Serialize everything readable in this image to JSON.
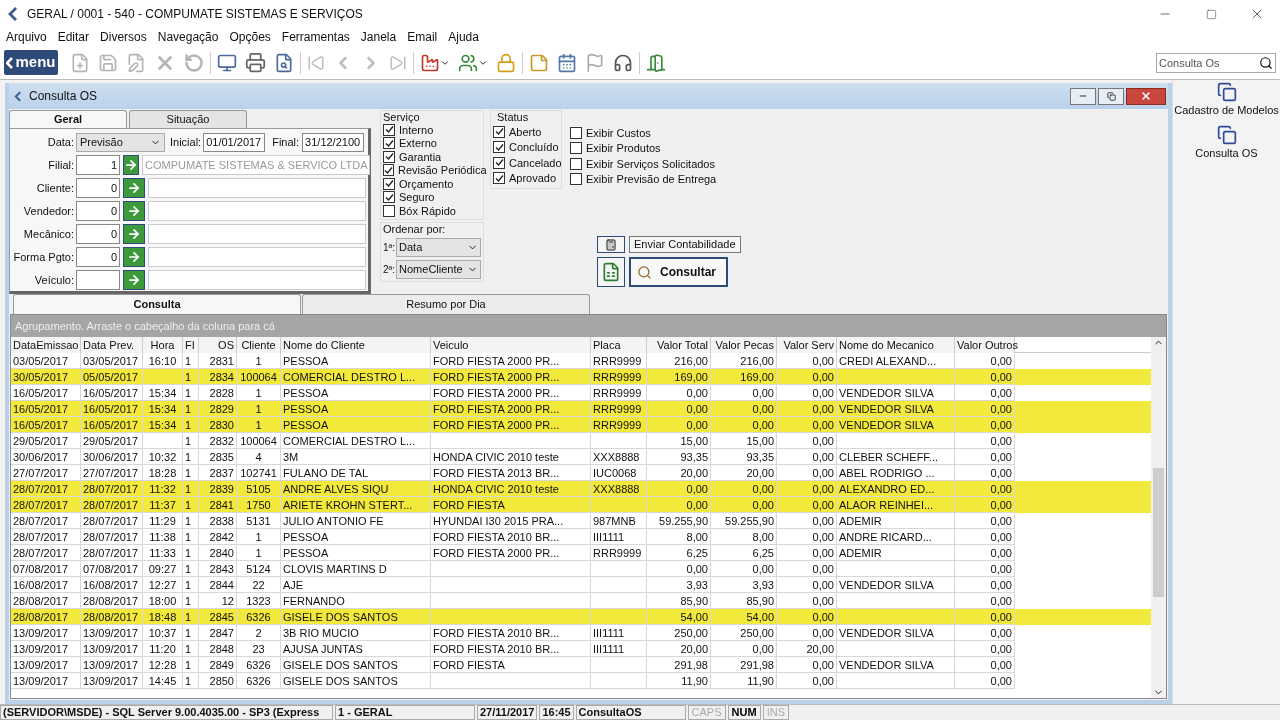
{
  "window": {
    "title": "GERAL / 0001 - 540 - COMPUMATE SISTEMAS E SERVIÇOS"
  },
  "menu": [
    "Arquivo",
    "Editar",
    "Diversos",
    "Navegação",
    "Opções",
    "Ferramentas",
    "Janela",
    "Email",
    "Ajuda"
  ],
  "toolbar": {
    "menu_button": "menu",
    "search": {
      "placeholder": "Consulta Os"
    }
  },
  "side_panel": [
    "Cadastro de Modelos",
    "Consulta OS"
  ],
  "child_window": {
    "title": "Consulta OS"
  },
  "top_tabs": [
    {
      "label": "Geral",
      "selected": true
    },
    {
      "label": "Situação",
      "selected": false
    }
  ],
  "date_row": {
    "label": "Data:",
    "value": "Previsão",
    "start_label": "Inicial:",
    "start": "01/01/2017",
    "end_label": "Final:",
    "end": "31/12/2100"
  },
  "filters": [
    {
      "label": "Filial:",
      "code": "1",
      "description": "COMPUMATE SISTEMAS & SERVICO LTDA"
    },
    {
      "label": "Cliente:",
      "code": "0"
    },
    {
      "label": "Vendedor:",
      "code": "0"
    },
    {
      "label": "Mecânico:",
      "code": "0"
    },
    {
      "label": "Forma Pgto:",
      "code": "0"
    },
    {
      "label": "Veículo:"
    }
  ],
  "servico": {
    "title": "Serviço",
    "items": [
      {
        "label": "Interno",
        "checked": true
      },
      {
        "label": "Externo",
        "checked": true
      },
      {
        "label": "Garantia",
        "checked": true
      },
      {
        "label": "Revisão Periódica",
        "checked": true
      },
      {
        "label": "Orçamento",
        "checked": true
      },
      {
        "label": "Seguro",
        "checked": true
      },
      {
        "label": "Bóx Rápido",
        "checked": false
      }
    ]
  },
  "status": {
    "title": "Status",
    "items": [
      {
        "label": "Aberto",
        "checked": true
      },
      {
        "label": "Concluído",
        "checked": true
      },
      {
        "label": "Cancelado",
        "checked": true
      },
      {
        "label": "Aprovado",
        "checked": true
      }
    ]
  },
  "options": [
    {
      "label": "Exibir Custos",
      "checked": false
    },
    {
      "label": "Exibir Produtos",
      "checked": false
    },
    {
      "label": "Exibir Serviços Solicitados",
      "checked": false
    },
    {
      "label": "Exibir Previsão de Entrega",
      "checked": false
    }
  ],
  "ordenar": {
    "title": "Ordenar por:",
    "items": [
      {
        "label": "1ª:",
        "value": "Data"
      },
      {
        "label": "2ª:",
        "value": "NomeCliente"
      }
    ]
  },
  "buttons": {
    "send": "Enviar Contabilidade",
    "search": "Consultar"
  },
  "bottom_tabs": [
    {
      "label": "Consulta",
      "selected": true
    },
    {
      "label": "Resumo por Dia",
      "selected": false
    }
  ],
  "group_bar": "Agrupamento. Arraste o cabeçalho da coluna para cá",
  "table": {
    "columns": [
      "DataEmissao",
      "Data Prev.",
      "Hora",
      "FI",
      "OS",
      "Cliente",
      "Nome do Cliente",
      "Veiculo",
      "Placa",
      "Valor Total",
      "Valor Pecas",
      "Valor Serv",
      "Nome do Mecanico",
      "Valor Outros"
    ],
    "rows": [
      {
        "highlighted": false,
        "cells": [
          "03/05/2017",
          "03/05/2017",
          "16:10",
          "1",
          "2831",
          "1",
          "PESSOA",
          "FORD FIESTA 2000 PR...",
          "RRR9999",
          "216,00",
          "216,00",
          "0,00",
          "CREDI ALEXAND...",
          "0,00"
        ]
      },
      {
        "highlighted": true,
        "cells": [
          "30/05/2017",
          "05/05/2017",
          null,
          "1",
          "2834",
          "100064",
          "COMERCIAL DESTRO L...",
          "FORD FIESTA 2000 PR...",
          "RRR9999",
          "169,00",
          "169,00",
          "0,00",
          null,
          "0,00"
        ]
      },
      {
        "highlighted": false,
        "cells": [
          "16/05/2017",
          "16/05/2017",
          "15:34",
          "1",
          "2828",
          "1",
          "PESSOA",
          "FORD FIESTA 2000 PR...",
          "RRR9999",
          "0,00",
          "0,00",
          "0,00",
          "VENDEDOR SILVA",
          "0,00"
        ]
      },
      {
        "highlighted": true,
        "cells": [
          "16/05/2017",
          "16/05/2017",
          "15:34",
          "1",
          "2829",
          "1",
          "PESSOA",
          "FORD FIESTA 2000 PR...",
          "RRR9999",
          "0,00",
          "0,00",
          "0,00",
          "VENDEDOR SILVA",
          "0,00"
        ]
      },
      {
        "highlighted": true,
        "cells": [
          "16/05/2017",
          "16/05/2017",
          "15:34",
          "1",
          "2830",
          "1",
          "PESSOA",
          "FORD FIESTA 2000 PR...",
          "RRR9999",
          "0,00",
          "0,00",
          "0,00",
          "VENDEDOR SILVA",
          "0,00"
        ]
      },
      {
        "highlighted": false,
        "cells": [
          "29/05/2017",
          "29/05/2017",
          null,
          "1",
          "2832",
          "100064",
          "COMERCIAL DESTRO L...",
          null,
          null,
          "15,00",
          "15,00",
          "0,00",
          null,
          "0,00"
        ]
      },
      {
        "highlighted": false,
        "cells": [
          "30/06/2017",
          "30/06/2017",
          "10:32",
          "1",
          "2835",
          "4",
          "3M",
          "HONDA CIVIC 2010  teste",
          "XXX8888",
          "93,35",
          "93,35",
          "0,00",
          "CLEBER SCHEFF...",
          "0,00"
        ]
      },
      {
        "highlighted": false,
        "cells": [
          "27/07/2017",
          "27/07/2017",
          "18:28",
          "1",
          "2837",
          "102741",
          "FULANO DE TAL",
          "FORD FIESTA 2013 BR...",
          "IUC0068",
          "20,00",
          "20,00",
          "0,00",
          "ABEL RODRIGO ...",
          "0,00"
        ]
      },
      {
        "highlighted": true,
        "cells": [
          "28/07/2017",
          "28/07/2017",
          "11:32",
          "1",
          "2839",
          "5105",
          "ANDRE ALVES SIQU",
          "HONDA CIVIC 2010  teste",
          "XXX8888",
          "0,00",
          "0,00",
          "0,00",
          "ALEXANDRO ED...",
          "0,00"
        ]
      },
      {
        "highlighted": true,
        "cells": [
          "28/07/2017",
          "28/07/2017",
          "11:37",
          "1",
          "2841",
          "1750",
          "ARIETE KROHN STERT...",
          "FORD FIESTA",
          null,
          "0,00",
          "0,00",
          "0,00",
          "ALAOR REINHEI...",
          "0,00"
        ]
      },
      {
        "highlighted": false,
        "cells": [
          "28/07/2017",
          "28/07/2017",
          "11:29",
          "1",
          "2838",
          "5131",
          "JULIO ANTONIO FE",
          "HYUNDAI I30 2015 PRA...",
          "987MNB",
          "59.255,90",
          "59.255,90",
          "0,00",
          "ADEMIR",
          "0,00"
        ]
      },
      {
        "highlighted": false,
        "cells": [
          "28/07/2017",
          "28/07/2017",
          "11:38",
          "1",
          "2842",
          "1",
          "PESSOA",
          "FORD FIESTA 2010 BR...",
          "III1111",
          "8,00",
          "8,00",
          "0,00",
          "ANDRE RICARD...",
          "0,00"
        ]
      },
      {
        "highlighted": false,
        "cells": [
          "28/07/2017",
          "28/07/2017",
          "11:33",
          "1",
          "2840",
          "1",
          "PESSOA",
          "FORD FIESTA 2000 PR...",
          "RRR9999",
          "6,25",
          "6,25",
          "0,00",
          "ADEMIR",
          "0,00"
        ]
      },
      {
        "highlighted": false,
        "cells": [
          "07/08/2017",
          "07/08/2017",
          "09:27",
          "1",
          "2843",
          "5124",
          "CLOVIS MARTINS D",
          null,
          null,
          "0,00",
          "0,00",
          "0,00",
          null,
          "0,00"
        ]
      },
      {
        "highlighted": false,
        "cells": [
          "16/08/2017",
          "16/08/2017",
          "12:27",
          "1",
          "2844",
          "22",
          "AJE",
          null,
          null,
          "3,93",
          "3,93",
          "0,00",
          "VENDEDOR SILVA",
          "0,00"
        ]
      },
      {
        "highlighted": false,
        "cells": [
          "28/08/2017",
          "28/08/2017",
          "18:00",
          "1",
          "12",
          "1323",
          "FERNANDO",
          null,
          null,
          "85,90",
          "85,90",
          "0,00",
          null,
          "0,00"
        ]
      },
      {
        "highlighted": true,
        "cells": [
          "28/08/2017",
          "28/08/2017",
          "18:48",
          "1",
          "2845",
          "6326",
          "GISELE DOS SANTOS",
          null,
          null,
          "54,00",
          "54,00",
          "0,00",
          null,
          "0,00"
        ]
      },
      {
        "highlighted": false,
        "cells": [
          "13/09/2017",
          "13/09/2017",
          "10:37",
          "1",
          "2847",
          "2",
          "3B RIO   MUCIO",
          "FORD FIESTA 2010 BR...",
          "III1111",
          "250,00",
          "250,00",
          "0,00",
          "VENDEDOR SILVA",
          "0,00"
        ]
      },
      {
        "highlighted": false,
        "cells": [
          "13/09/2017",
          "13/09/2017",
          "11:20",
          "1",
          "2848",
          "23",
          "AJUSA JUNTAS",
          "FORD FIESTA 2010 BR...",
          "III1111",
          "20,00",
          "0,00",
          "20,00",
          null,
          "0,00"
        ]
      },
      {
        "highlighted": false,
        "cells": [
          "13/09/2017",
          "13/09/2017",
          "12:28",
          "1",
          "2849",
          "6326",
          "GISELE DOS SANTOS",
          "FORD FIESTA",
          null,
          "291,98",
          "291,98",
          "0,00",
          "VENDEDOR SILVA",
          "0,00"
        ]
      },
      {
        "highlighted": false,
        "cells": [
          "13/09/2017",
          "13/09/2017",
          "14:45",
          "1",
          "2850",
          "6326",
          "GISELE DOS SANTOS",
          null,
          null,
          "11,90",
          "11,90",
          "0,00",
          null,
          "0,00"
        ]
      }
    ]
  },
  "status_bar": {
    "server": "(SERVIDOR\\MSDE) - SQL Server 9.00.4035.00 - SP3 (Express",
    "company": "1 - GERAL",
    "date": "27/11/2017",
    "time": "16:45",
    "screen": "ConsultaOS",
    "keys": [
      {
        "label": "CAPS",
        "on": false
      },
      {
        "label": "NUM",
        "on": true
      },
      {
        "label": "INS",
        "on": false
      }
    ]
  }
}
